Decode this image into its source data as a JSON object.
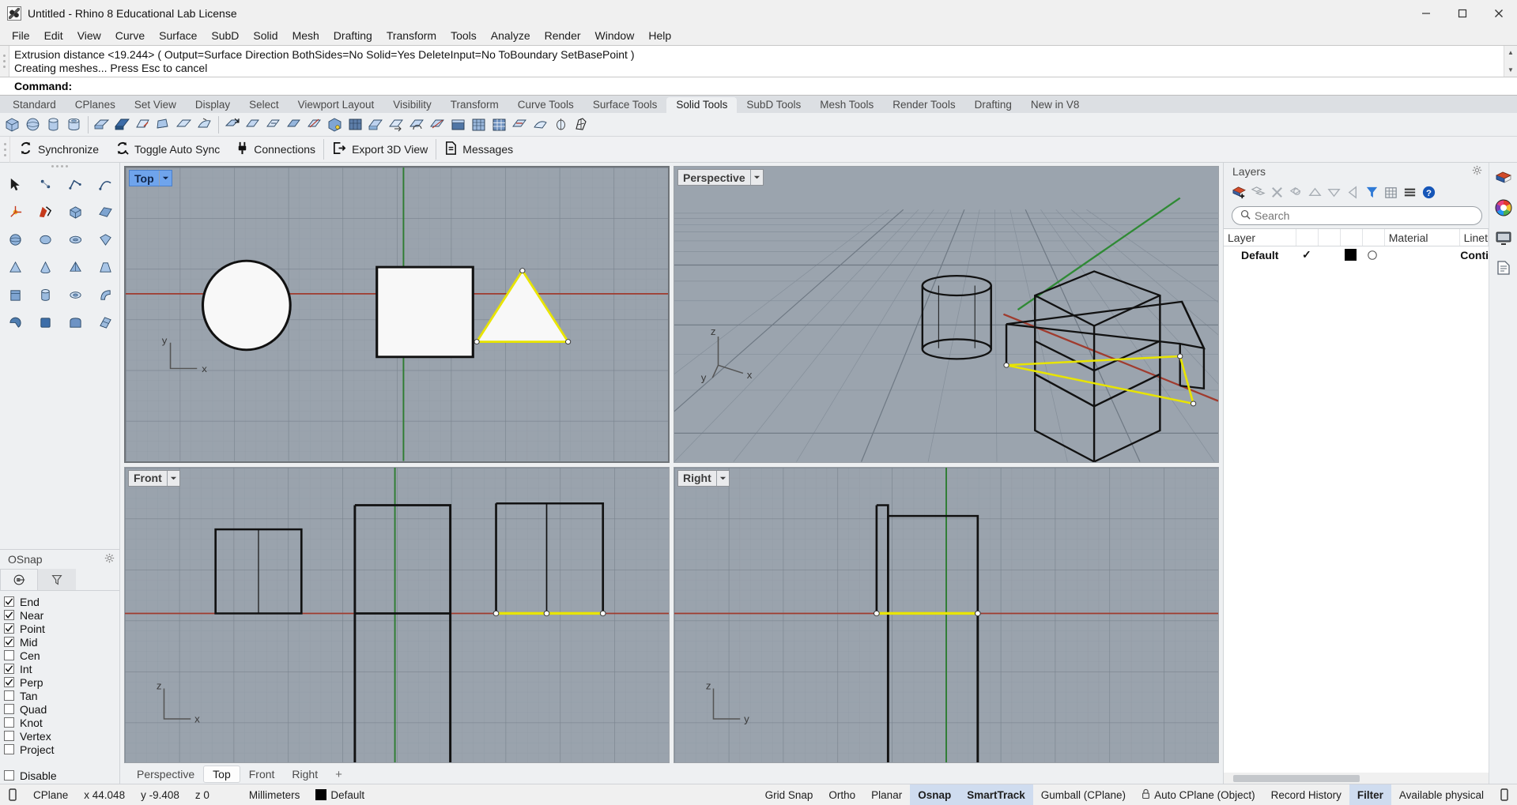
{
  "window": {
    "title": "Untitled - Rhino 8 Educational Lab License",
    "icon": "rhino-logo-icon",
    "minimize": "minimize-button",
    "maximize": "maximize-button",
    "close": "close-button"
  },
  "menubar": {
    "items": [
      {
        "label": "File"
      },
      {
        "label": "Edit"
      },
      {
        "label": "View"
      },
      {
        "label": "Curve"
      },
      {
        "label": "Surface"
      },
      {
        "label": "SubD"
      },
      {
        "label": "Solid"
      },
      {
        "label": "Mesh"
      },
      {
        "label": "Drafting"
      },
      {
        "label": "Transform"
      },
      {
        "label": "Tools"
      },
      {
        "label": "Analyze"
      },
      {
        "label": "Render"
      },
      {
        "label": "Window"
      },
      {
        "label": "Help"
      }
    ]
  },
  "command_history": {
    "lines": [
      "Extrusion distance <19.244> ( Output=Surface  Direction  BothSides=No  Solid=Yes  DeleteInput=No  ToBoundary  SetBasePoint )",
      "Creating meshes... Press Esc to cancel"
    ],
    "prompt_label": "Command:",
    "prompt_value": ""
  },
  "ribbon": {
    "tabs": [
      {
        "label": "Standard",
        "active": false
      },
      {
        "label": "CPlanes",
        "active": false
      },
      {
        "label": "Set View",
        "active": false
      },
      {
        "label": "Display",
        "active": false
      },
      {
        "label": "Select",
        "active": false
      },
      {
        "label": "Viewport Layout",
        "active": false
      },
      {
        "label": "Visibility",
        "active": false
      },
      {
        "label": "Transform",
        "active": false
      },
      {
        "label": "Curve Tools",
        "active": false
      },
      {
        "label": "Surface Tools",
        "active": false
      },
      {
        "label": "Solid Tools",
        "active": true
      },
      {
        "label": "SubD Tools",
        "active": false
      },
      {
        "label": "Mesh Tools",
        "active": false
      },
      {
        "label": "Render Tools",
        "active": false
      },
      {
        "label": "Drafting",
        "active": false
      },
      {
        "label": "New in V8",
        "active": false
      }
    ]
  },
  "plugin_toolbar": {
    "items": [
      {
        "label": "Synchronize",
        "icon": "sync-icon"
      },
      {
        "label": "Toggle Auto Sync",
        "icon": "auto-sync-icon"
      },
      {
        "label": "Connections",
        "icon": "plug-icon"
      },
      {
        "label": "Export 3D View",
        "icon": "export-icon"
      },
      {
        "label": "Messages",
        "icon": "document-icon"
      }
    ]
  },
  "osnap": {
    "title": "OSnap",
    "gear": "gear-icon",
    "tabs": [
      {
        "icon": "osnap-target-icon",
        "active": true
      },
      {
        "icon": "filter-funnel-icon",
        "active": false
      }
    ],
    "options": [
      {
        "label": "End",
        "checked": true
      },
      {
        "label": "Near",
        "checked": true
      },
      {
        "label": "Point",
        "checked": true
      },
      {
        "label": "Mid",
        "checked": true
      },
      {
        "label": "Cen",
        "checked": false
      },
      {
        "label": "Int",
        "checked": true
      },
      {
        "label": "Perp",
        "checked": true
      },
      {
        "label": "Tan",
        "checked": false
      },
      {
        "label": "Quad",
        "checked": false
      },
      {
        "label": "Knot",
        "checked": false
      },
      {
        "label": "Vertex",
        "checked": false
      },
      {
        "label": "Project",
        "checked": false
      }
    ],
    "disable": {
      "label": "Disable",
      "checked": false
    }
  },
  "viewports": {
    "top_left": {
      "label": "Top",
      "active": true
    },
    "top_right": {
      "label": "Perspective",
      "active": false
    },
    "bottom_left": {
      "label": "Front",
      "active": false
    },
    "bottom_right": {
      "label": "Right",
      "active": false
    },
    "axis_labels": {
      "top": {
        "h": "x",
        "v": "y"
      },
      "persp": {
        "x": "x",
        "y": "y",
        "z": "z"
      },
      "front": {
        "h": "x",
        "v": "z"
      },
      "right": {
        "h": "y",
        "v": "z"
      }
    },
    "tabs": [
      {
        "label": "Perspective",
        "active": false
      },
      {
        "label": "Top",
        "active": true
      },
      {
        "label": "Front",
        "active": false
      },
      {
        "label": "Right",
        "active": false
      },
      {
        "label": "+",
        "active": false
      }
    ]
  },
  "layers_panel": {
    "title": "Layers",
    "gear": "gear-icon",
    "toolbar_icons": [
      "new-layer-icon",
      "new-sublayer-icon",
      "delete-layer-icon",
      "copy-layer-icon",
      "move-up-icon",
      "move-down-icon",
      "move-left-icon",
      "filter-icon",
      "grid-icon",
      "menu-icon",
      "help-icon"
    ],
    "search_placeholder": "Search",
    "search_value": "",
    "columns": [
      "Layer",
      "",
      "",
      "",
      "",
      "Material",
      "Linet"
    ],
    "rows": [
      {
        "name": "Default",
        "on": "✓",
        "color": "#000000",
        "material": "default-material-circle",
        "linetype": "Conti"
      }
    ]
  },
  "right_rail": {
    "icons": [
      "layers-rail-icon",
      "color-wheel-icon",
      "display-icon",
      "properties-icon"
    ]
  },
  "statusbar": {
    "lock_icon": "toggle-icon",
    "cplane_label": "CPlane",
    "x": "x 44.048",
    "y": "y -9.408",
    "z": "z 0",
    "units": "Millimeters",
    "layer_swatch": "#000000",
    "layer_name": "Default",
    "toggles": [
      {
        "label": "Grid Snap",
        "on": false
      },
      {
        "label": "Ortho",
        "on": false
      },
      {
        "label": "Planar",
        "on": false
      },
      {
        "label": "Osnap",
        "on": true
      },
      {
        "label": "SmartTrack",
        "on": true
      },
      {
        "label": "Gumball (CPlane)",
        "on": false
      },
      {
        "label": "Auto CPlane (Object)",
        "on": false,
        "icon": "padlock-icon"
      },
      {
        "label": "Record History",
        "on": false
      },
      {
        "label": "Filter",
        "on": true
      },
      {
        "label": "Available physical",
        "on": false
      }
    ]
  }
}
